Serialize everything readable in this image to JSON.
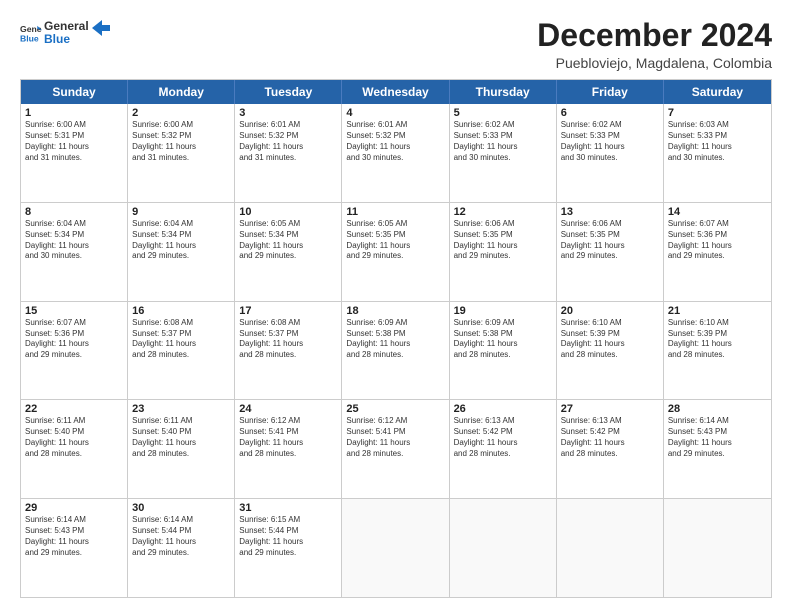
{
  "logo": {
    "line1": "General",
    "line2": "Blue"
  },
  "title": "December 2024",
  "subtitle": "Puebloviejo, Magdalena, Colombia",
  "header_days": [
    "Sunday",
    "Monday",
    "Tuesday",
    "Wednesday",
    "Thursday",
    "Friday",
    "Saturday"
  ],
  "weeks": [
    [
      {
        "day": "1",
        "lines": [
          "Sunrise: 6:00 AM",
          "Sunset: 5:31 PM",
          "Daylight: 11 hours",
          "and 31 minutes."
        ]
      },
      {
        "day": "2",
        "lines": [
          "Sunrise: 6:00 AM",
          "Sunset: 5:32 PM",
          "Daylight: 11 hours",
          "and 31 minutes."
        ]
      },
      {
        "day": "3",
        "lines": [
          "Sunrise: 6:01 AM",
          "Sunset: 5:32 PM",
          "Daylight: 11 hours",
          "and 31 minutes."
        ]
      },
      {
        "day": "4",
        "lines": [
          "Sunrise: 6:01 AM",
          "Sunset: 5:32 PM",
          "Daylight: 11 hours",
          "and 30 minutes."
        ]
      },
      {
        "day": "5",
        "lines": [
          "Sunrise: 6:02 AM",
          "Sunset: 5:33 PM",
          "Daylight: 11 hours",
          "and 30 minutes."
        ]
      },
      {
        "day": "6",
        "lines": [
          "Sunrise: 6:02 AM",
          "Sunset: 5:33 PM",
          "Daylight: 11 hours",
          "and 30 minutes."
        ]
      },
      {
        "day": "7",
        "lines": [
          "Sunrise: 6:03 AM",
          "Sunset: 5:33 PM",
          "Daylight: 11 hours",
          "and 30 minutes."
        ]
      }
    ],
    [
      {
        "day": "8",
        "lines": [
          "Sunrise: 6:04 AM",
          "Sunset: 5:34 PM",
          "Daylight: 11 hours",
          "and 30 minutes."
        ]
      },
      {
        "day": "9",
        "lines": [
          "Sunrise: 6:04 AM",
          "Sunset: 5:34 PM",
          "Daylight: 11 hours",
          "and 29 minutes."
        ]
      },
      {
        "day": "10",
        "lines": [
          "Sunrise: 6:05 AM",
          "Sunset: 5:34 PM",
          "Daylight: 11 hours",
          "and 29 minutes."
        ]
      },
      {
        "day": "11",
        "lines": [
          "Sunrise: 6:05 AM",
          "Sunset: 5:35 PM",
          "Daylight: 11 hours",
          "and 29 minutes."
        ]
      },
      {
        "day": "12",
        "lines": [
          "Sunrise: 6:06 AM",
          "Sunset: 5:35 PM",
          "Daylight: 11 hours",
          "and 29 minutes."
        ]
      },
      {
        "day": "13",
        "lines": [
          "Sunrise: 6:06 AM",
          "Sunset: 5:35 PM",
          "Daylight: 11 hours",
          "and 29 minutes."
        ]
      },
      {
        "day": "14",
        "lines": [
          "Sunrise: 6:07 AM",
          "Sunset: 5:36 PM",
          "Daylight: 11 hours",
          "and 29 minutes."
        ]
      }
    ],
    [
      {
        "day": "15",
        "lines": [
          "Sunrise: 6:07 AM",
          "Sunset: 5:36 PM",
          "Daylight: 11 hours",
          "and 29 minutes."
        ]
      },
      {
        "day": "16",
        "lines": [
          "Sunrise: 6:08 AM",
          "Sunset: 5:37 PM",
          "Daylight: 11 hours",
          "and 28 minutes."
        ]
      },
      {
        "day": "17",
        "lines": [
          "Sunrise: 6:08 AM",
          "Sunset: 5:37 PM",
          "Daylight: 11 hours",
          "and 28 minutes."
        ]
      },
      {
        "day": "18",
        "lines": [
          "Sunrise: 6:09 AM",
          "Sunset: 5:38 PM",
          "Daylight: 11 hours",
          "and 28 minutes."
        ]
      },
      {
        "day": "19",
        "lines": [
          "Sunrise: 6:09 AM",
          "Sunset: 5:38 PM",
          "Daylight: 11 hours",
          "and 28 minutes."
        ]
      },
      {
        "day": "20",
        "lines": [
          "Sunrise: 6:10 AM",
          "Sunset: 5:39 PM",
          "Daylight: 11 hours",
          "and 28 minutes."
        ]
      },
      {
        "day": "21",
        "lines": [
          "Sunrise: 6:10 AM",
          "Sunset: 5:39 PM",
          "Daylight: 11 hours",
          "and 28 minutes."
        ]
      }
    ],
    [
      {
        "day": "22",
        "lines": [
          "Sunrise: 6:11 AM",
          "Sunset: 5:40 PM",
          "Daylight: 11 hours",
          "and 28 minutes."
        ]
      },
      {
        "day": "23",
        "lines": [
          "Sunrise: 6:11 AM",
          "Sunset: 5:40 PM",
          "Daylight: 11 hours",
          "and 28 minutes."
        ]
      },
      {
        "day": "24",
        "lines": [
          "Sunrise: 6:12 AM",
          "Sunset: 5:41 PM",
          "Daylight: 11 hours",
          "and 28 minutes."
        ]
      },
      {
        "day": "25",
        "lines": [
          "Sunrise: 6:12 AM",
          "Sunset: 5:41 PM",
          "Daylight: 11 hours",
          "and 28 minutes."
        ]
      },
      {
        "day": "26",
        "lines": [
          "Sunrise: 6:13 AM",
          "Sunset: 5:42 PM",
          "Daylight: 11 hours",
          "and 28 minutes."
        ]
      },
      {
        "day": "27",
        "lines": [
          "Sunrise: 6:13 AM",
          "Sunset: 5:42 PM",
          "Daylight: 11 hours",
          "and 28 minutes."
        ]
      },
      {
        "day": "28",
        "lines": [
          "Sunrise: 6:14 AM",
          "Sunset: 5:43 PM",
          "Daylight: 11 hours",
          "and 29 minutes."
        ]
      }
    ],
    [
      {
        "day": "29",
        "lines": [
          "Sunrise: 6:14 AM",
          "Sunset: 5:43 PM",
          "Daylight: 11 hours",
          "and 29 minutes."
        ]
      },
      {
        "day": "30",
        "lines": [
          "Sunrise: 6:14 AM",
          "Sunset: 5:44 PM",
          "Daylight: 11 hours",
          "and 29 minutes."
        ]
      },
      {
        "day": "31",
        "lines": [
          "Sunrise: 6:15 AM",
          "Sunset: 5:44 PM",
          "Daylight: 11 hours",
          "and 29 minutes."
        ]
      },
      {
        "day": "",
        "lines": []
      },
      {
        "day": "",
        "lines": []
      },
      {
        "day": "",
        "lines": []
      },
      {
        "day": "",
        "lines": []
      }
    ]
  ]
}
